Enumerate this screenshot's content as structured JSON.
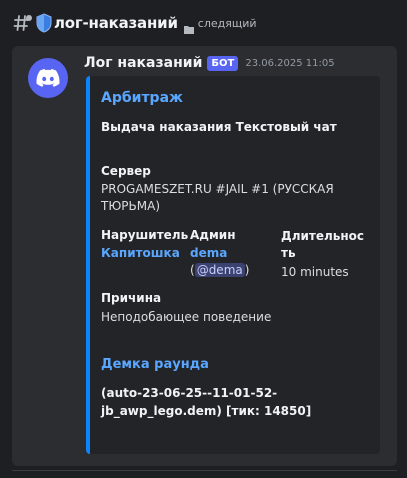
{
  "channel": {
    "name": "лог-наказаний",
    "follow_label": "следящий"
  },
  "message": {
    "author": "Лог наказаний",
    "bot_badge": "БОТ",
    "timestamp": "23.06.2025 11:05",
    "embed": {
      "accent_color": "#0a84ff",
      "title": "Арбитраж",
      "description": "Выдача наказания Текстовый чат",
      "server": {
        "name": "Сервер",
        "value_line1": "PROGAMESZET.RU #JAIL #1 (РУССКАЯ",
        "value_line2": "ТЮРЬМА)"
      },
      "offender": {
        "name": "Нарушитель",
        "value": "Капитошка"
      },
      "admin": {
        "name": "Админ",
        "value": "dema",
        "mention_open": "(",
        "mention": "@dema",
        "mention_close": ")"
      },
      "duration": {
        "name_line1": "Длительнос",
        "name_line2": "ть",
        "value": "10 minutes"
      },
      "reason": {
        "name": "Причина",
        "value": "Неподобающее поведение"
      },
      "demo": {
        "name": "Демка раунда",
        "value_line1": "(auto-23-06-25--11-01-52-",
        "value_line2": "jb_awp_lego.dem) [тик: 14850]"
      }
    }
  },
  "icons": {
    "channel": "hash-icon",
    "shield": "shield-icon",
    "folder": "folder-icon",
    "avatar": "discord-logo-icon"
  }
}
